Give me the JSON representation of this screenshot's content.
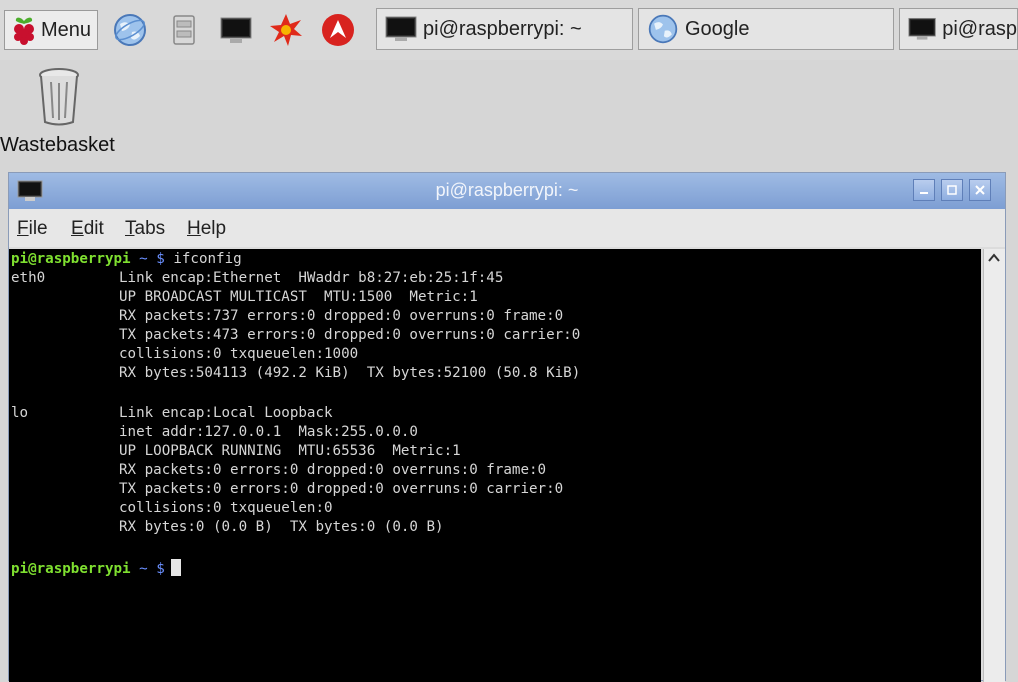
{
  "taskbar": {
    "menu_label": "Menu",
    "launchers": [
      "web-browser-icon",
      "file-manager-icon",
      "terminal-icon",
      "wolfram-icon",
      "mathematica-icon"
    ],
    "tasks": [
      {
        "label": "pi@raspberrypi: ~",
        "icon": "terminal-icon"
      },
      {
        "label": "Google",
        "icon": "web-browser-icon"
      },
      {
        "label": "pi@rasp",
        "icon": "terminal-icon"
      }
    ]
  },
  "desktop": {
    "wastebasket_label": "Wastebasket"
  },
  "window": {
    "title": "pi@raspberrypi: ~",
    "menu": [
      {
        "underline": "F",
        "rest": "ile"
      },
      {
        "underline": "E",
        "rest": "dit"
      },
      {
        "underline": "T",
        "rest": "abs"
      },
      {
        "underline": "H",
        "rest": "elp"
      }
    ]
  },
  "terminal": {
    "prompt_user": "pi@raspberrypi",
    "prompt_path": "~",
    "prompt_symbol": "$",
    "command": "ifconfig",
    "eth0": {
      "name": "eth0",
      "lines": [
        "Link encap:Ethernet  HWaddr b8:27:eb:25:1f:45",
        "UP BROADCAST MULTICAST  MTU:1500  Metric:1",
        "RX packets:737 errors:0 dropped:0 overruns:0 frame:0",
        "TX packets:473 errors:0 dropped:0 overruns:0 carrier:0",
        "collisions:0 txqueuelen:1000",
        "RX bytes:504113 (492.2 KiB)  TX bytes:52100 (50.8 KiB)"
      ]
    },
    "lo": {
      "name": "lo",
      "lines": [
        "Link encap:Local Loopback",
        "inet addr:127.0.0.1  Mask:255.0.0.0",
        "UP LOOPBACK RUNNING  MTU:65536  Metric:1",
        "RX packets:0 errors:0 dropped:0 overruns:0 frame:0",
        "TX packets:0 errors:0 dropped:0 overruns:0 carrier:0",
        "collisions:0 txqueuelen:0",
        "RX bytes:0 (0.0 B)  TX bytes:0 (0.0 B)"
      ]
    }
  },
  "colors": {
    "prompt_user": "#7fe030",
    "prompt_path": "#6a8fff",
    "titlebar": "#8eaee0",
    "terminal_bg": "#000000"
  }
}
